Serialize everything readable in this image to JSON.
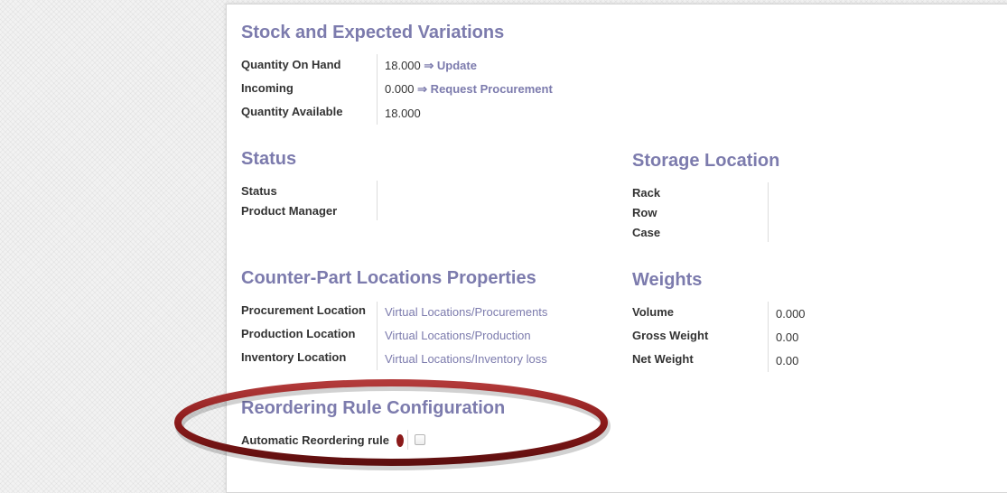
{
  "stock": {
    "title": "Stock and Expected Variations",
    "qty_on_hand_label": "Quantity On Hand",
    "qty_on_hand_value": "18.000",
    "update_link": "⇒ Update",
    "incoming_label": "Incoming",
    "incoming_value": "0.000",
    "request_procurement_link": "⇒ Request Procurement",
    "qty_available_label": "Quantity Available",
    "qty_available_value": "18.000"
  },
  "status": {
    "title": "Status",
    "status_label": "Status",
    "product_manager_label": "Product Manager"
  },
  "storage": {
    "title": "Storage Location",
    "rack_label": "Rack",
    "row_label": "Row",
    "case_label": "Case"
  },
  "counterpart": {
    "title": "Counter-Part Locations Properties",
    "procurement_label": "Procurement Location",
    "procurement_value": "Virtual Locations/Procurements",
    "production_label": "Production Location",
    "production_value": "Virtual Locations/Production",
    "inventory_label": "Inventory Location",
    "inventory_value": "Virtual Locations/Inventory loss"
  },
  "weights": {
    "title": "Weights",
    "volume_label": "Volume",
    "volume_value": "0.000",
    "gross_label": "Gross Weight",
    "gross_value": "0.00",
    "net_label": "Net Weight",
    "net_value": "0.00"
  },
  "reordering": {
    "title": "Reordering Rule Configuration",
    "auto_label": "Automatic Reordering rule",
    "auto_checked": false
  },
  "colors": {
    "section_title": "#7c7bad",
    "annotation": "#8b1a1a"
  }
}
